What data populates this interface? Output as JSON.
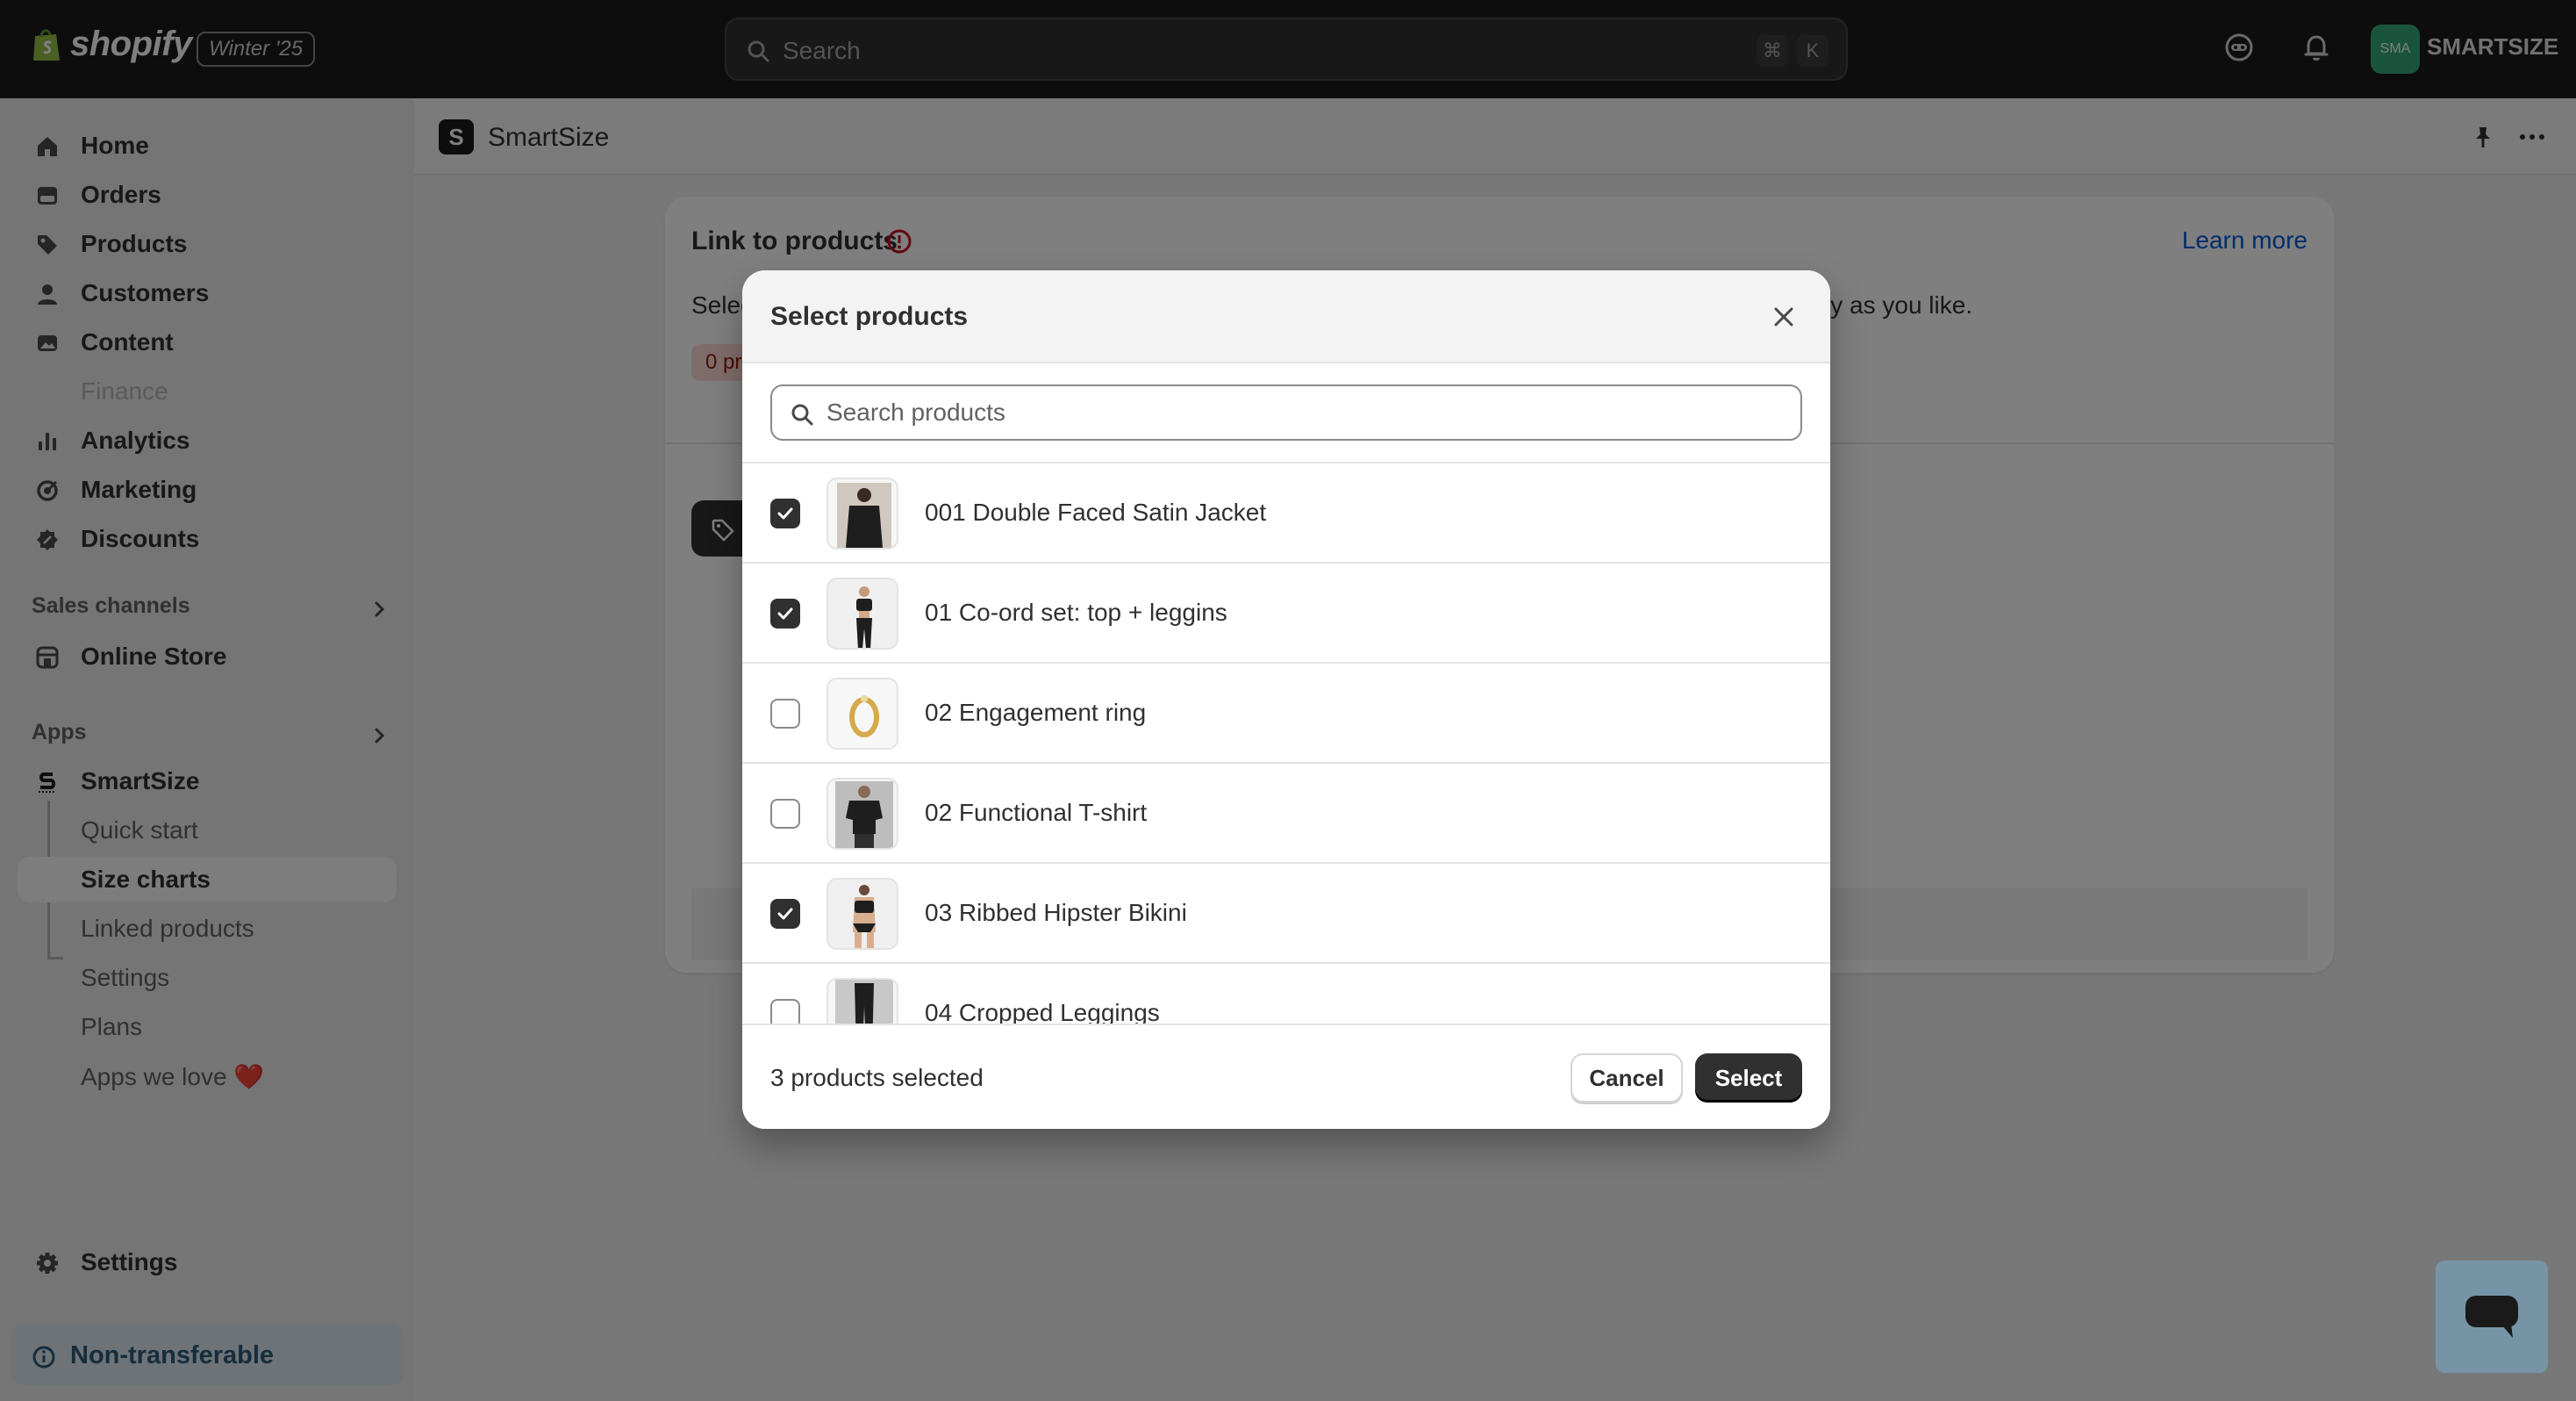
{
  "topbar": {
    "brand": "shopify",
    "edition": "Winter '25",
    "search_placeholder": "Search",
    "shortcut_cmd": "⌘",
    "shortcut_key": "K",
    "store_initials": "SMA",
    "store_name": "SMARTSIZE"
  },
  "sidebar": {
    "items": [
      {
        "label": "Home",
        "icon": "home-icon"
      },
      {
        "label": "Orders",
        "icon": "orders-icon"
      },
      {
        "label": "Products",
        "icon": "tag-icon"
      },
      {
        "label": "Customers",
        "icon": "person-icon"
      },
      {
        "label": "Content",
        "icon": "content-icon"
      },
      {
        "label": "Finance",
        "icon": "bank-icon",
        "disabled": true
      },
      {
        "label": "Analytics",
        "icon": "bar-chart-icon"
      },
      {
        "label": "Marketing",
        "icon": "target-icon"
      },
      {
        "label": "Discounts",
        "icon": "discount-icon"
      }
    ],
    "sales_channels_label": "Sales channels",
    "online_store": "Online Store",
    "apps_label": "Apps",
    "app_name": "SmartSize",
    "app_subitems": [
      "Quick start",
      "Size charts",
      "Linked products",
      "Settings",
      "Plans",
      "Apps we love ❤️"
    ],
    "active_subitem": "Size charts",
    "settings": "Settings",
    "non_transferable": "Non-transferable"
  },
  "app_header": {
    "title": "SmartSize",
    "logo_letter": "S"
  },
  "card": {
    "title": "Link to products",
    "learn_more": "Learn more",
    "desc_left": "Selec",
    "desc_right": "s many as you like.",
    "badge": "0 pr"
  },
  "modal": {
    "title": "Select products",
    "search_placeholder": "Search products",
    "products": [
      {
        "name": "001 Double Faced Satin Jacket",
        "checked": true,
        "thumb": "jacket"
      },
      {
        "name": "01 Co-ord set: top + leggins",
        "checked": true,
        "thumb": "coord"
      },
      {
        "name": "02 Engagement ring",
        "checked": false,
        "thumb": "ring"
      },
      {
        "name": "02 Functional T-shirt",
        "checked": false,
        "thumb": "tshirt"
      },
      {
        "name": "03 Ribbed Hipster Bikini",
        "checked": true,
        "thumb": "bikini"
      },
      {
        "name": "04 Cropped Leggings",
        "checked": false,
        "thumb": "leggings"
      }
    ],
    "selected_count": "3 products selected",
    "cancel_label": "Cancel",
    "select_label": "Select"
  },
  "colors": {
    "topbar_bg": "#1a1a1a",
    "primary_button": "#303030",
    "link": "#005bd3",
    "critical": "#c70a24",
    "store_avatar": "#36a97a"
  }
}
